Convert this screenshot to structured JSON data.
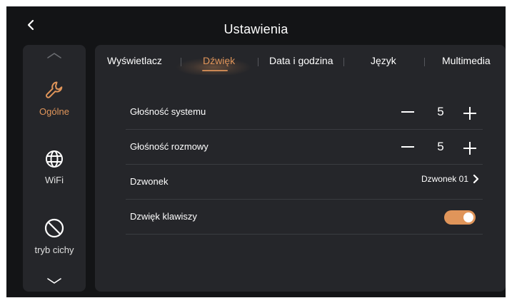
{
  "header": {
    "title": "Ustawienia",
    "back_icon": "chevron-left-icon"
  },
  "sidebar": {
    "up_icon": "chevron-up-icon",
    "down_icon": "chevron-down-icon",
    "items": [
      {
        "label": "Ogólne",
        "icon": "wrench-icon",
        "active": true
      },
      {
        "label": "WiFi",
        "icon": "globe-icon",
        "active": false
      },
      {
        "label": "tryb cichy",
        "icon": "no-entry-icon",
        "active": false
      }
    ]
  },
  "tabs": [
    {
      "label": "Wyświetlacz",
      "active": false
    },
    {
      "label": "Dźwięk",
      "active": true
    },
    {
      "label": "Data i godzina",
      "active": false
    },
    {
      "label": "Język",
      "active": false
    },
    {
      "label": "Multimedia",
      "active": false
    }
  ],
  "settings": {
    "system_volume": {
      "label": "Głośność systemu",
      "value": "5"
    },
    "call_volume": {
      "label": "Głośność rozmowy",
      "value": "5"
    },
    "ringtone": {
      "label": "Dzwonek",
      "value": "Dzwonek 01"
    },
    "key_sound": {
      "label": "Dzwięk klawiszy",
      "enabled": true
    }
  },
  "colors": {
    "accent": "#e0955a",
    "background": "#131416",
    "panel": "#25262a",
    "text": "#ffffff"
  }
}
